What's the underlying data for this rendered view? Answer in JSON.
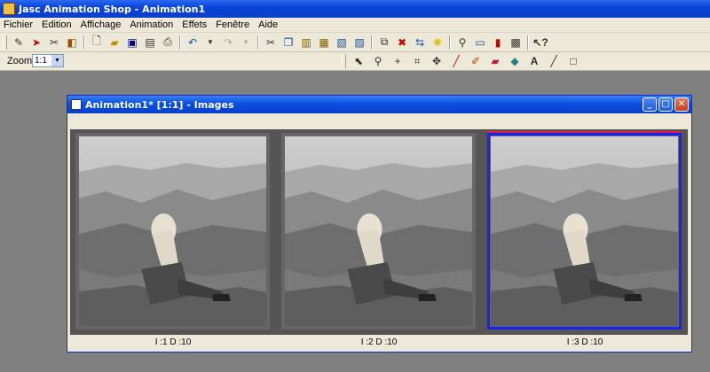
{
  "app": {
    "title": "Jasc Animation Shop - Animation1"
  },
  "menu": {
    "items": [
      "Fichier",
      "Edition",
      "Affichage",
      "Animation",
      "Effets",
      "Fenêtre",
      "Aide"
    ]
  },
  "toolbar2": {
    "zoom_label": "Zoom :",
    "zoom_value": "1:1"
  },
  "child_window": {
    "title": "Animation1* [1:1] - Images"
  },
  "frames": [
    {
      "label": "I :1   D :10",
      "selected": false
    },
    {
      "label": "I :2   D :10",
      "selected": false
    },
    {
      "label": "I :3   D :10",
      "selected": true
    }
  ],
  "colors": {
    "titlebar": "#0a45d8",
    "selection_border": "#1820ff",
    "selection_top": "#e0203a",
    "face": "#ece9d8"
  }
}
